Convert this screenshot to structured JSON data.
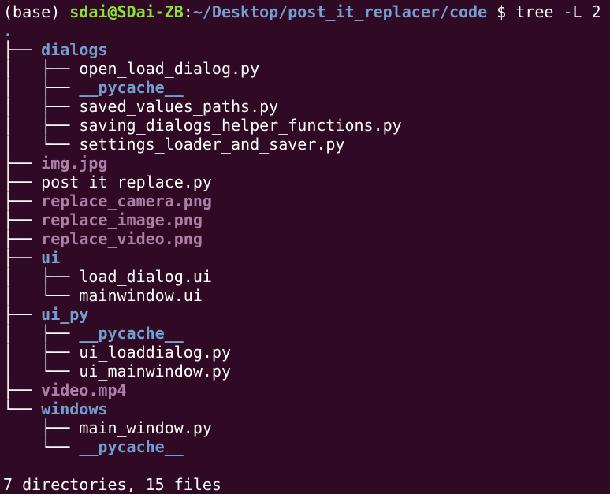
{
  "prompt": {
    "env": "(base) ",
    "user_host": "sdai@SDai-ZB",
    "separator": ":",
    "path": "~/Desktop/post_it_replacer/code",
    "dollar": " $ ",
    "command": "tree -L 2"
  },
  "tree": {
    "root": ".",
    "entries": [
      {
        "prefix": "├── ",
        "name": "dialogs",
        "kind": "dir"
      },
      {
        "prefix": "│   ├── ",
        "name": "open_load_dialog.py",
        "kind": "file"
      },
      {
        "prefix": "│   ├── ",
        "name": "__pycache__",
        "kind": "dir"
      },
      {
        "prefix": "│   ├── ",
        "name": "saved_values_paths.py",
        "kind": "file"
      },
      {
        "prefix": "│   ├── ",
        "name": "saving_dialogs_helper_functions.py",
        "kind": "file"
      },
      {
        "prefix": "│   └── ",
        "name": "settings_loader_and_saver.py",
        "kind": "file"
      },
      {
        "prefix": "├── ",
        "name": "img.jpg",
        "kind": "image"
      },
      {
        "prefix": "├── ",
        "name": "post_it_replace.py",
        "kind": "file"
      },
      {
        "prefix": "├── ",
        "name": "replace_camera.png",
        "kind": "image"
      },
      {
        "prefix": "├── ",
        "name": "replace_image.png",
        "kind": "image"
      },
      {
        "prefix": "├── ",
        "name": "replace_video.png",
        "kind": "image"
      },
      {
        "prefix": "├── ",
        "name": "ui",
        "kind": "dir"
      },
      {
        "prefix": "│   ├── ",
        "name": "load_dialog.ui",
        "kind": "file"
      },
      {
        "prefix": "│   └── ",
        "name": "mainwindow.ui",
        "kind": "file"
      },
      {
        "prefix": "├── ",
        "name": "ui_py",
        "kind": "dir"
      },
      {
        "prefix": "│   ├── ",
        "name": "__pycache__",
        "kind": "dir"
      },
      {
        "prefix": "│   ├── ",
        "name": "ui_loaddialog.py",
        "kind": "file"
      },
      {
        "prefix": "│   └── ",
        "name": "ui_mainwindow.py",
        "kind": "file"
      },
      {
        "prefix": "├── ",
        "name": "video.mp4",
        "kind": "image"
      },
      {
        "prefix": "└── ",
        "name": "windows",
        "kind": "dir"
      },
      {
        "prefix": "    ├── ",
        "name": "main_window.py",
        "kind": "file"
      },
      {
        "prefix": "    └── ",
        "name": "__pycache__",
        "kind": "dir"
      }
    ],
    "summary": "7 directories, 15 files"
  },
  "colors": {
    "background": "#300a24",
    "user_host": "#8ae234",
    "path": "#729fcf",
    "directory": "#729fcf",
    "image_file": "#ad7fa8",
    "text": "#ffffff"
  }
}
